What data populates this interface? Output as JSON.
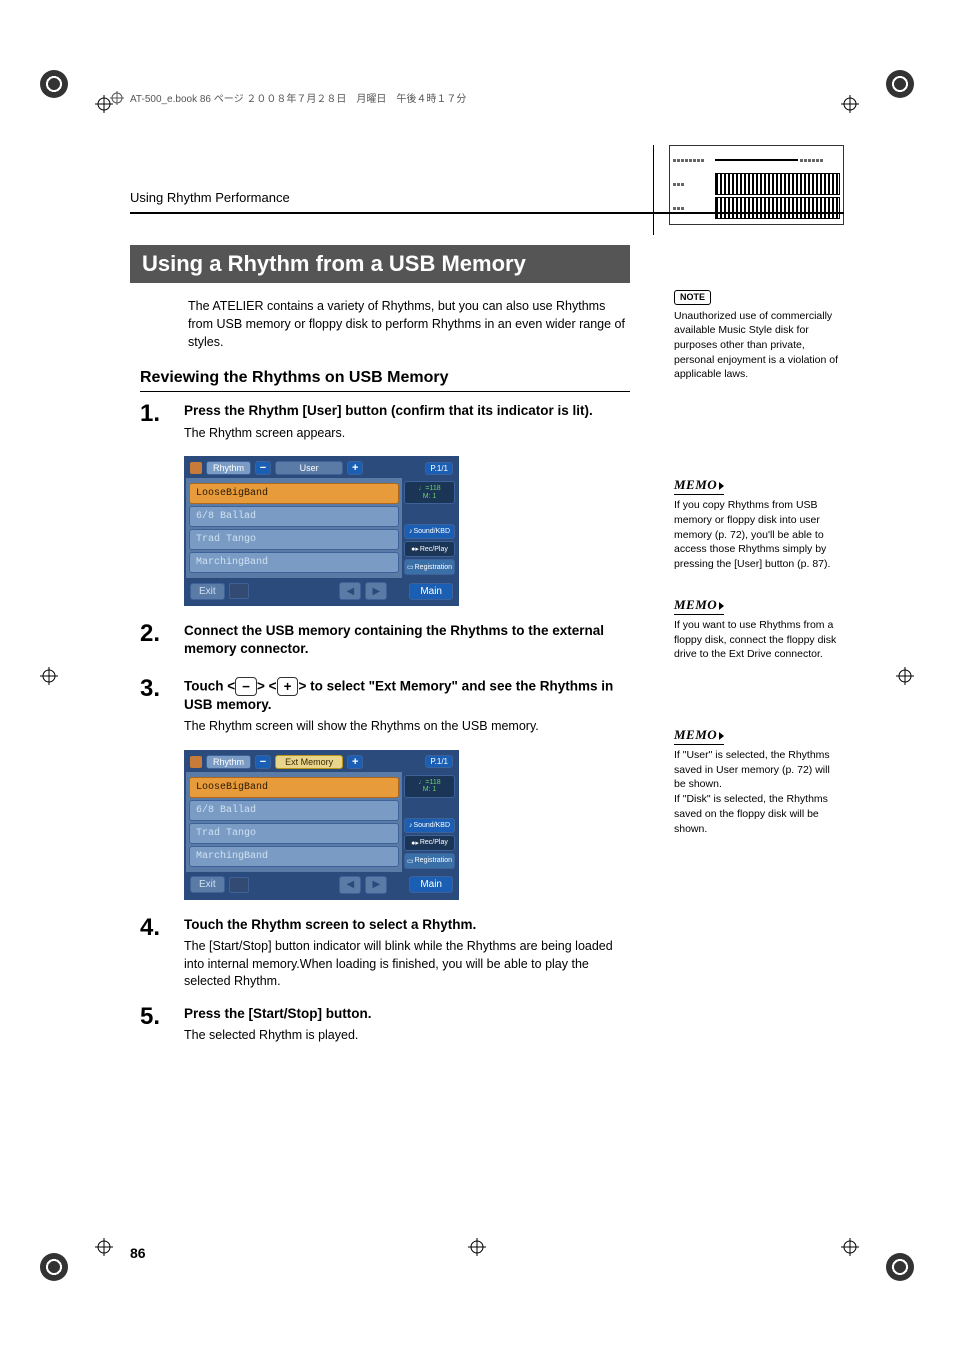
{
  "header": {
    "file_info": "AT-500_e.book  86 ページ  ２００８年７月２８日　月曜日　午後４時１７分"
  },
  "chapter": "Using Rhythm Performance",
  "title": "Using a Rhythm from a USB Memory",
  "intro": "The ATELIER contains a variety of Rhythms, but you can also use Rhythms from USB memory or floppy disk to perform Rhythms in an even wider range of styles.",
  "subheading": "Reviewing the Rhythms on USB Memory",
  "steps": [
    {
      "num": "1.",
      "instr": "Press the Rhythm [User] button (confirm that its indicator is lit).",
      "desc": "The Rhythm screen appears."
    },
    {
      "num": "2.",
      "instr": "Connect the USB memory containing the Rhythms to the external memory connector.",
      "desc": ""
    },
    {
      "num": "3.",
      "instr_prefix": "Touch <",
      "instr_mid": "> <",
      "instr_suffix": "> to select \"Ext Memory\" and see the Rhythms in USB memory.",
      "minus": "−",
      "plus": "+",
      "desc": "The Rhythm screen will show the Rhythms on the USB memory."
    },
    {
      "num": "4.",
      "instr": "Touch the Rhythm screen to select a Rhythm.",
      "desc": "The [Start/Stop] button indicator will blink while the Rhythms are being loaded into internal memory.When loading is finished, you will be able to play the selected Rhythm."
    },
    {
      "num": "5.",
      "instr": "Press the [Start/Stop] button.",
      "desc": "The selected Rhythm is played."
    }
  ],
  "screenshot1": {
    "title": "Rhythm",
    "tab": "User",
    "page": "P.1/1",
    "tempo_top": "♩=118",
    "tempo_bot": "M:   1",
    "items": [
      "LooseBigBand",
      "6/8 Ballad",
      "Trad Tango",
      "MarchingBand"
    ],
    "sound": "Sound/KBD",
    "rec": "Rec/Play",
    "reg": "Registration",
    "exit": "Exit",
    "main": "Main",
    "minus": "−",
    "plus": "+"
  },
  "screenshot2": {
    "title": "Rhythm",
    "tab": "Ext Memory",
    "page": "P.1/1",
    "tempo_top": "♩=118",
    "tempo_bot": "M:   1",
    "items": [
      "LooseBigBand",
      "6/8 Ballad",
      "Trad Tango",
      "MarchingBand"
    ],
    "sound": "Sound/KBD",
    "rec": "Rec/Play",
    "reg": "Registration",
    "exit": "Exit",
    "main": "Main",
    "minus": "−",
    "plus": "+"
  },
  "sidebar": {
    "note_label": "NOTE",
    "note_text": "Unauthorized use of commercially available Music Style disk for purposes other than private, personal enjoyment is a violation of applicable laws.",
    "memo_label": "MEMO",
    "memo1": "If you copy Rhythms from USB memory or floppy disk into user memory (p. 72), you'll be able to access those Rhythms simply by pressing the [User] button (p. 87).",
    "memo2": "If you want to use Rhythms from a floppy disk, connect the floppy disk drive to the Ext Drive connector.",
    "memo3": "If \"User\" is selected, the Rhythms saved in User memory (p. 72) will be shown.\nIf \"Disk\" is selected, the Rhythms saved on the floppy disk will be shown."
  },
  "page_num": "86"
}
